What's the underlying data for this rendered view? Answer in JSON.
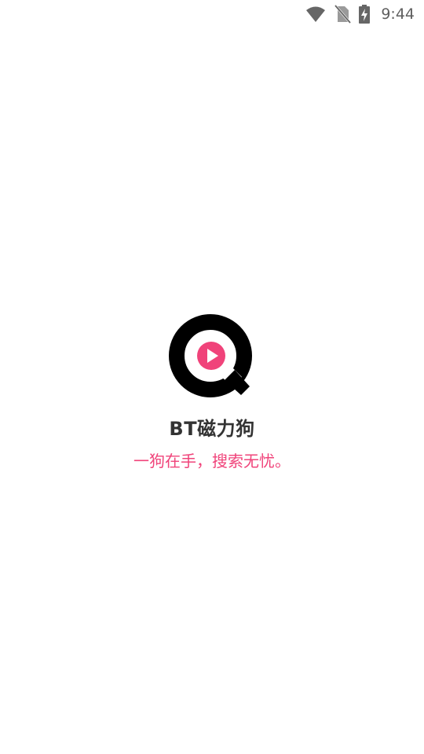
{
  "status_bar": {
    "time": "9:44",
    "icons": [
      "wifi-icon",
      "no-sim-icon",
      "battery-charging-icon"
    ]
  },
  "splash": {
    "logo_icon": "magnifier-play-icon",
    "app_name": "BT磁力狗",
    "slogan": "一狗在手，搜索无忧。"
  },
  "colors": {
    "accent": "#f0437a",
    "logo_ring": "#000000",
    "app_name_text": "#333333",
    "status_icons": "#666666",
    "background": "#ffffff"
  }
}
